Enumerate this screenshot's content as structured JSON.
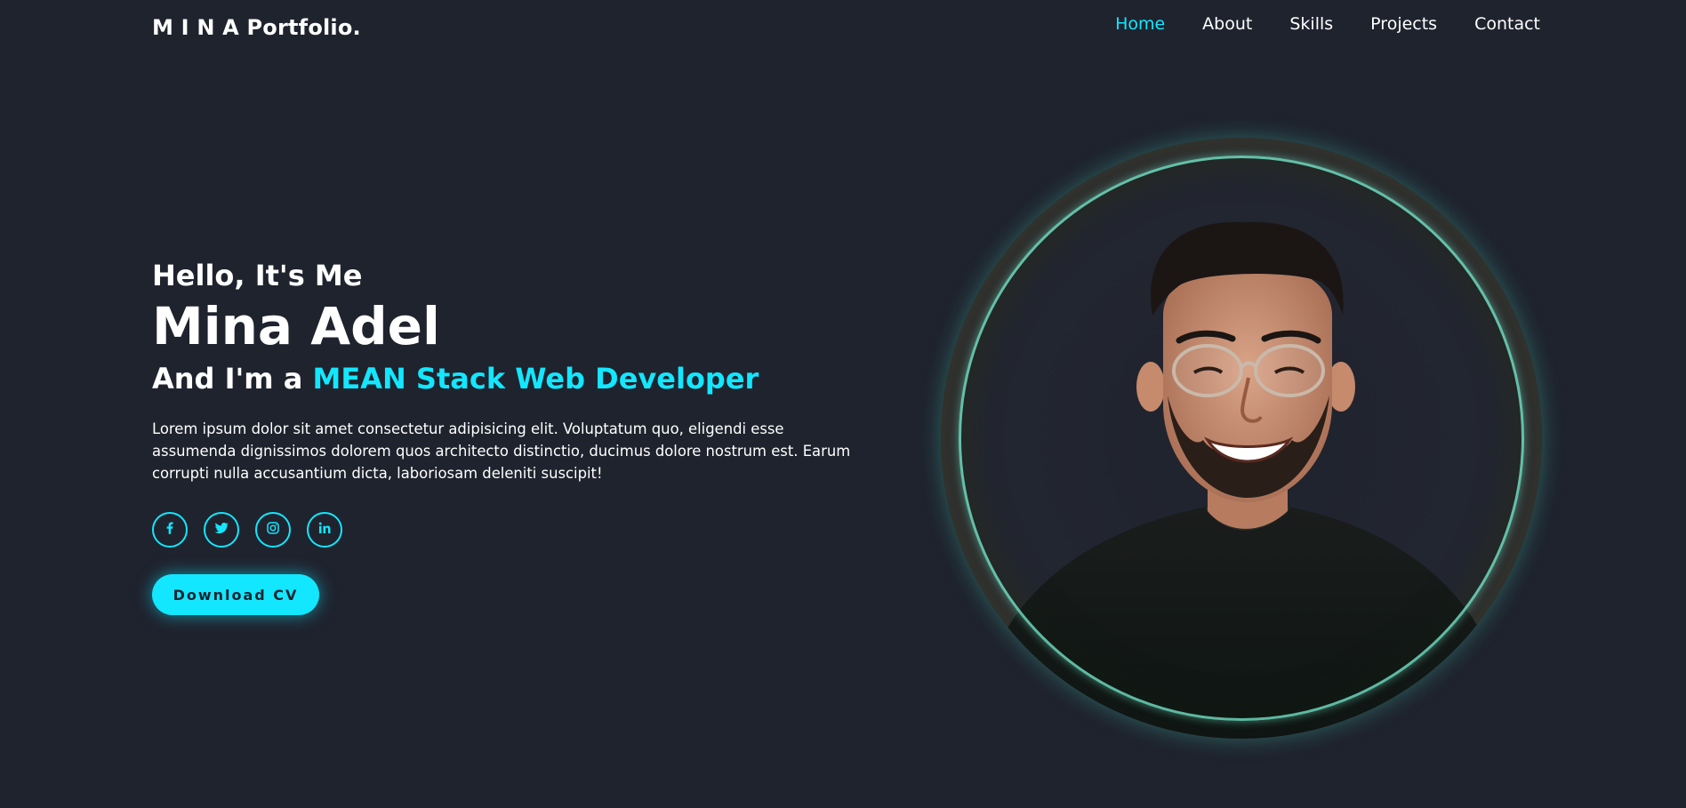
{
  "header": {
    "logo": "M I N A Portfolio.",
    "nav": [
      {
        "label": "Home",
        "active": true
      },
      {
        "label": "About",
        "active": false
      },
      {
        "label": "Skills",
        "active": false
      },
      {
        "label": "Projects",
        "active": false
      },
      {
        "label": "Contact",
        "active": false
      }
    ]
  },
  "hero": {
    "greeting": "Hello, It's Me",
    "name": "Mina Adel",
    "role_prefix": "And I'm a ",
    "role": "MEAN Stack Web Developer",
    "description": "Lorem ipsum dolor sit amet consectetur adipisicing elit. Voluptatum quo, eligendi esse assumenda dignissimos dolorem quos architecto distinctio, ducimus dolore nostrum est. Earum corrupti nulla accusantium dicta, laboriosam deleniti suscipit!",
    "socials": [
      {
        "icon": "facebook-icon"
      },
      {
        "icon": "twitter-icon"
      },
      {
        "icon": "instagram-icon"
      },
      {
        "icon": "linkedin-icon"
      }
    ],
    "cv_button": "Download CV"
  },
  "colors": {
    "background": "#1f232e",
    "accent": "#12e7ff",
    "text": "#ffffff",
    "ring_glow": "#5fe0c8"
  }
}
